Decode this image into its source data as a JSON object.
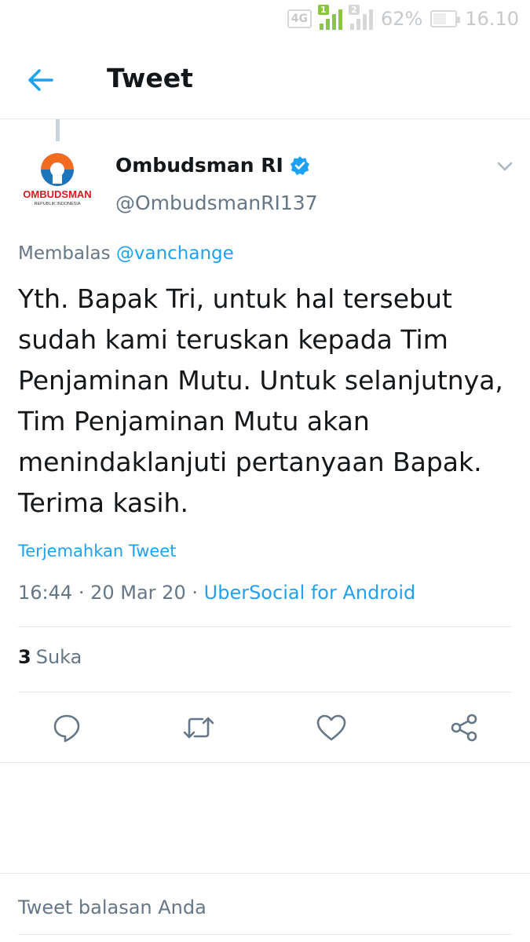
{
  "status_bar": {
    "network": "4G",
    "sim1": "1",
    "sim2": "2",
    "battery": "62%",
    "battery_level": 0.62,
    "time": "16.10"
  },
  "header": {
    "back_icon": "arrow-left-icon",
    "title": "Tweet"
  },
  "tweet": {
    "avatar_text": "OMBUDSMAN",
    "avatar_subtext": "REPUBLIK INDONESIA",
    "author_name": "Ombudsman RI",
    "verified_icon": "verified-badge-icon",
    "author_handle": "@OmbudsmanRI137",
    "reply_prefix": "Membalas",
    "reply_mention": "@vanchange",
    "text": "Yth. Bapak Tri, untuk hal tersebut sudah kami teruskan kepada Tim Penjaminan Mutu. Untuk selanjutnya, Tim Penjaminan Mutu akan menindaklanjuti pertanyaan Bapak. Terima kasih.",
    "translate_label": "Terjemahkan Tweet",
    "time": "16:44",
    "date": "20 Mar 20",
    "source": "UberSocial for Android",
    "likes_count": "3",
    "likes_label": "Suka"
  },
  "actions": {
    "reply_icon": "reply-icon",
    "retweet_icon": "retweet-icon",
    "like_icon": "heart-icon",
    "share_icon": "share-icon"
  },
  "compose": {
    "placeholder": "Tweet balasan Anda"
  },
  "colors": {
    "accent": "#1da1f2",
    "text": "#14171a",
    "muted": "#657786",
    "border": "#e1e8ed",
    "signal": "#8cc63f"
  }
}
